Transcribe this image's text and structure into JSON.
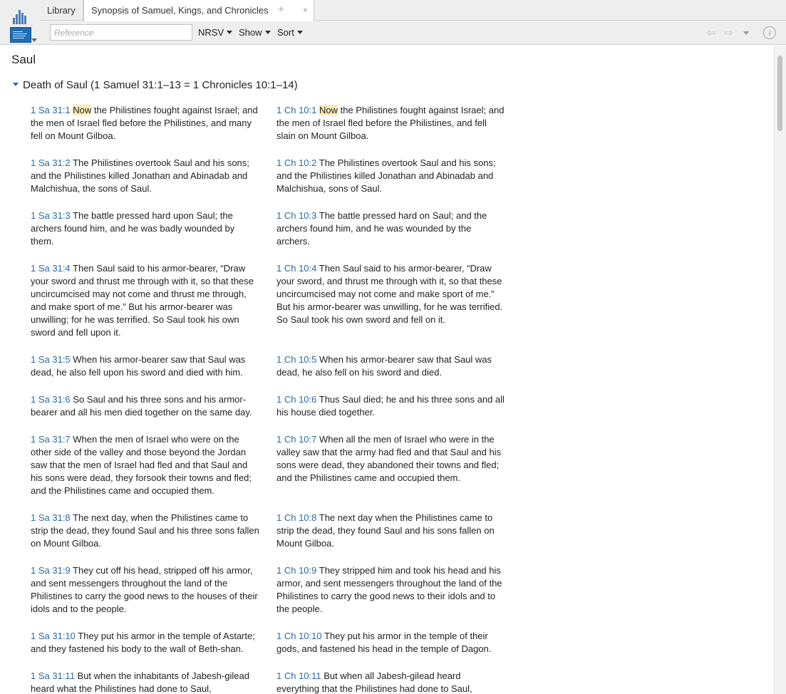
{
  "tabs": {
    "library": "Library",
    "active": "Synopsis of Samuel, Kings, and Chronicles",
    "close": "×",
    "add": "+"
  },
  "toolbar": {
    "reference_placeholder": "Reference",
    "version": "NRSV",
    "show": "Show",
    "sort": "Sort",
    "back_icon": "⇦",
    "forward_icon": "⇨",
    "info_icon": "i"
  },
  "page_title": "Saul",
  "section_heading": "Death of Saul (1 Samuel 31:1–13 = 1 Chronicles 10:1–14)",
  "verses": [
    {
      "left_ref": "1 Sa 31:1",
      "left_highlight": "Now",
      "left_text": " the Philistines fought against Israel; and the men of Israel fled before the Philistines, and many fell on Mount Gilboa.",
      "right_ref": "1 Ch 10:1",
      "right_highlight": "Now",
      "right_text": " the Philistines fought against Israel; and the men of Israel fled before the Philistines, and fell slain on Mount Gilboa."
    },
    {
      "left_ref": "1 Sa 31:2",
      "left_text": " The Philistines overtook Saul and his sons; and the Philistines killed Jonathan and Abinadab and Malchishua, the sons of Saul.",
      "right_ref": "1 Ch 10:2",
      "right_text": " The Philistines overtook Saul and his sons; and the Philistines killed Jonathan and Abinadab and Malchishua, sons of Saul."
    },
    {
      "left_ref": "1 Sa 31:3",
      "left_text": " The battle pressed hard upon Saul; the archers found him, and he was badly wounded by them.",
      "right_ref": "1 Ch 10:3",
      "right_text": " The battle pressed hard on Saul; and the archers found him, and he was wounded by the archers."
    },
    {
      "left_ref": "1 Sa 31:4",
      "left_text": " Then Saul said to his armor-bearer, “Draw your sword and thrust me through with it, so that these uncircumcised may not come and thrust me through, and make sport of me.” But his armor-bearer was unwilling; for he was terrified. So Saul took his own sword and fell upon it.",
      "right_ref": "1 Ch 10:4",
      "right_text": " Then Saul said to his armor-bearer, “Draw your sword, and thrust me through with it, so that these uncircumcised may not come and make sport of me.” But his armor-bearer was unwilling, for he was terrified. So Saul took his own sword and fell on it."
    },
    {
      "left_ref": "1 Sa 31:5",
      "left_text": " When his armor-bearer saw that Saul was dead, he also fell upon his sword and died with him.",
      "right_ref": "1 Ch 10:5",
      "right_text": " When his armor-bearer saw that Saul was dead, he also fell on his sword and died."
    },
    {
      "left_ref": "1 Sa 31:6",
      "left_text": " So Saul and his three sons and his armor-bearer and all his men died together on the same day.",
      "right_ref": "1 Ch 10:6",
      "right_text": " Thus Saul died; he and his three sons and all his house died together."
    },
    {
      "left_ref": "1 Sa 31:7",
      "left_text": " When the men of Israel who were on the other side of the valley and those beyond the Jordan saw that the men of Israel had fled and that Saul and his sons were dead, they forsook their towns and fled; and the Philistines came and occupied them.",
      "right_ref": "1 Ch 10:7",
      "right_text": " When all the men of Israel who were in the valley saw that the army had fled and that Saul and his sons were dead, they abandoned their towns and fled; and the Philistines came and occupied them."
    },
    {
      "left_ref": "1 Sa 31:8",
      "left_text": " The next day, when the Philistines came to strip the dead, they found Saul and his three sons fallen on Mount Gilboa.",
      "right_ref": "1 Ch 10:8",
      "right_text": " The next day when the Philistines came to strip the dead, they found Saul and his sons fallen on Mount Gilboa."
    },
    {
      "left_ref": "1 Sa 31:9",
      "left_text": " They cut off his head, stripped off his armor, and sent messengers throughout the land of the Philistines to carry the good news to the houses of their idols and to the people.",
      "right_ref": "1 Ch 10:9",
      "right_text": " They stripped him and took his head and his armor, and sent messengers throughout the land of the Philistines to carry the good news to their idols and to the people."
    },
    {
      "left_ref": "1 Sa 31:10",
      "left_text": " They put his armor in the temple of Astarte; and they fastened his body to the wall of Beth-shan.",
      "right_ref": "1 Ch 10:10",
      "right_text": " They put his armor in the temple of their gods, and fastened his head in the temple of Dagon."
    },
    {
      "left_ref": "1 Sa 31:11",
      "left_text": " But when the inhabitants of Jabesh-gilead heard what the Philistines had done to Saul,",
      "right_ref": "1 Ch 10:11",
      "right_text": " But when all Jabesh-gilead heard everything that the Philistines had done to Saul,"
    }
  ]
}
